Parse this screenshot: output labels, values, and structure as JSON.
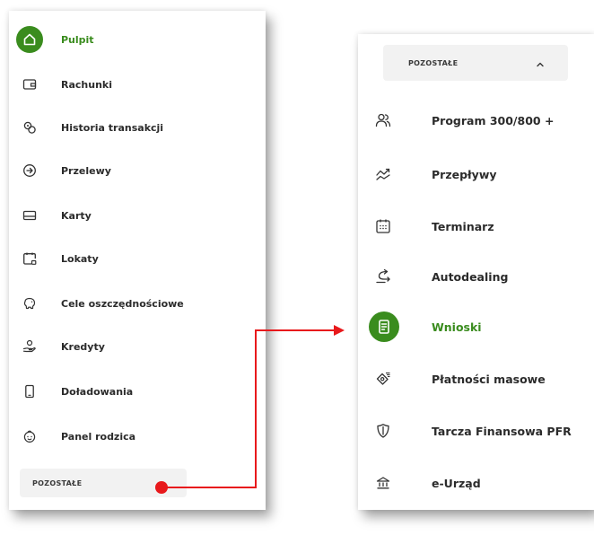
{
  "left_menu": {
    "items": [
      {
        "label": "Pulpit",
        "icon": "home-icon"
      },
      {
        "label": "Rachunki",
        "icon": "wallet-icon"
      },
      {
        "label": "Historia transakcji",
        "icon": "coins-icon"
      },
      {
        "label": "Przelewy",
        "icon": "arrow-circle-icon"
      },
      {
        "label": "Karty",
        "icon": "card-icon"
      },
      {
        "label": "Lokaty",
        "icon": "calendar-lock-icon"
      },
      {
        "label": "Cele oszczędnościowe",
        "icon": "piggy-bank-icon"
      },
      {
        "label": "Kredyty",
        "icon": "hand-coins-icon"
      },
      {
        "label": "Doładowania",
        "icon": "phone-icon"
      },
      {
        "label": "Panel rodzica",
        "icon": "child-face-icon"
      }
    ],
    "active_index": 0,
    "section": {
      "label": "POZOSTAŁE",
      "state": "collapsed"
    }
  },
  "right_menu": {
    "section": {
      "label": "POZOSTAŁE",
      "state": "expanded"
    },
    "items": [
      {
        "label": "Program 300/800 +",
        "icon": "family-icon"
      },
      {
        "label": "Przepływy",
        "icon": "trend-icon"
      },
      {
        "label": "Terminarz",
        "icon": "calendar-icon"
      },
      {
        "label": "Autodealing",
        "icon": "exchange-icon"
      },
      {
        "label": "Wnioski",
        "icon": "document-icon"
      },
      {
        "label": "Płatności masowe",
        "icon": "mass-payment-icon"
      },
      {
        "label": "Tarcza Finansowa PFR",
        "icon": "shield-icon"
      },
      {
        "label": "e-Urząd",
        "icon": "government-building-icon"
      }
    ],
    "active_index": 4
  },
  "colors": {
    "accent": "#3a8c1e",
    "connector": "#e8191c",
    "text": "#2b2b2b",
    "section_bg": "#f2f2f2"
  }
}
